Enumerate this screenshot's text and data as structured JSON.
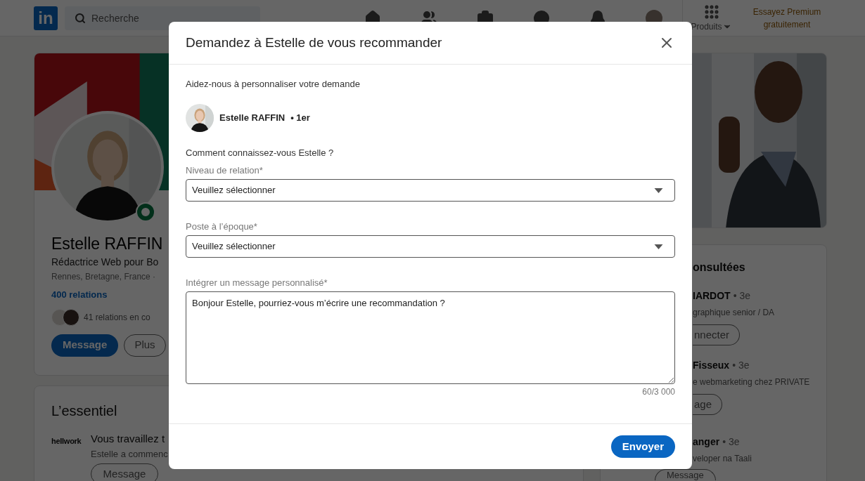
{
  "header": {
    "logo": "in",
    "search_placeholder": "Recherche",
    "products": "Produits",
    "premium": "Essayez Premium gratuitement"
  },
  "profile": {
    "name": "Estelle RAFFIN",
    "headline": "Rédactrice Web pour Bo",
    "location": "Rennes, Bretagne, France ·",
    "relations": "400 relations",
    "mutual": "41 relations en co",
    "online": true,
    "buttons": [
      {
        "label": "Message",
        "primary": true
      },
      {
        "label": "Plus",
        "primary": false
      }
    ]
  },
  "essentials": {
    "title": "L’essentiel",
    "logo": "hellwork",
    "heading": "Vous travaillez t",
    "text": "Estelle a commenc",
    "button": "Message"
  },
  "sidebar": {
    "title": "onsultées",
    "people": [
      {
        "name": "IARDOT",
        "degree": "• 3e",
        "headline": "graphique senior / DA",
        "button": "nnecter",
        "cut": true
      },
      {
        "name": "Fisseux",
        "degree": "• 3e",
        "headline": "e webmarketing chez PRIVATE",
        "button": "age",
        "cut": true
      },
      {
        "name": "anger",
        "degree": "• 3e",
        "headline": "veloper na Taali",
        "button": "Message",
        "cut": false
      }
    ]
  },
  "dialog": {
    "title": "Demandez à Estelle de vous recommander",
    "intro": "Aidez-nous à personnaliser votre demande",
    "person": {
      "name": "Estelle RAFFIN",
      "degree": "• 1er"
    },
    "question": "Comment connaissez-vous Estelle ?",
    "fields": [
      {
        "kind": "select",
        "label": "Niveau de relation*",
        "value": "Veuillez sélectionner"
      },
      {
        "kind": "select",
        "label": "Poste à l’époque*",
        "value": "Veuillez sélectionner"
      },
      {
        "kind": "textarea",
        "label": "Intégrer un message personnalisé*",
        "value": "Bonjour Estelle, pourriez-vous m’écrire une recommandation ?",
        "counter": "60/3 000"
      }
    ],
    "submit": "Envoyer"
  }
}
